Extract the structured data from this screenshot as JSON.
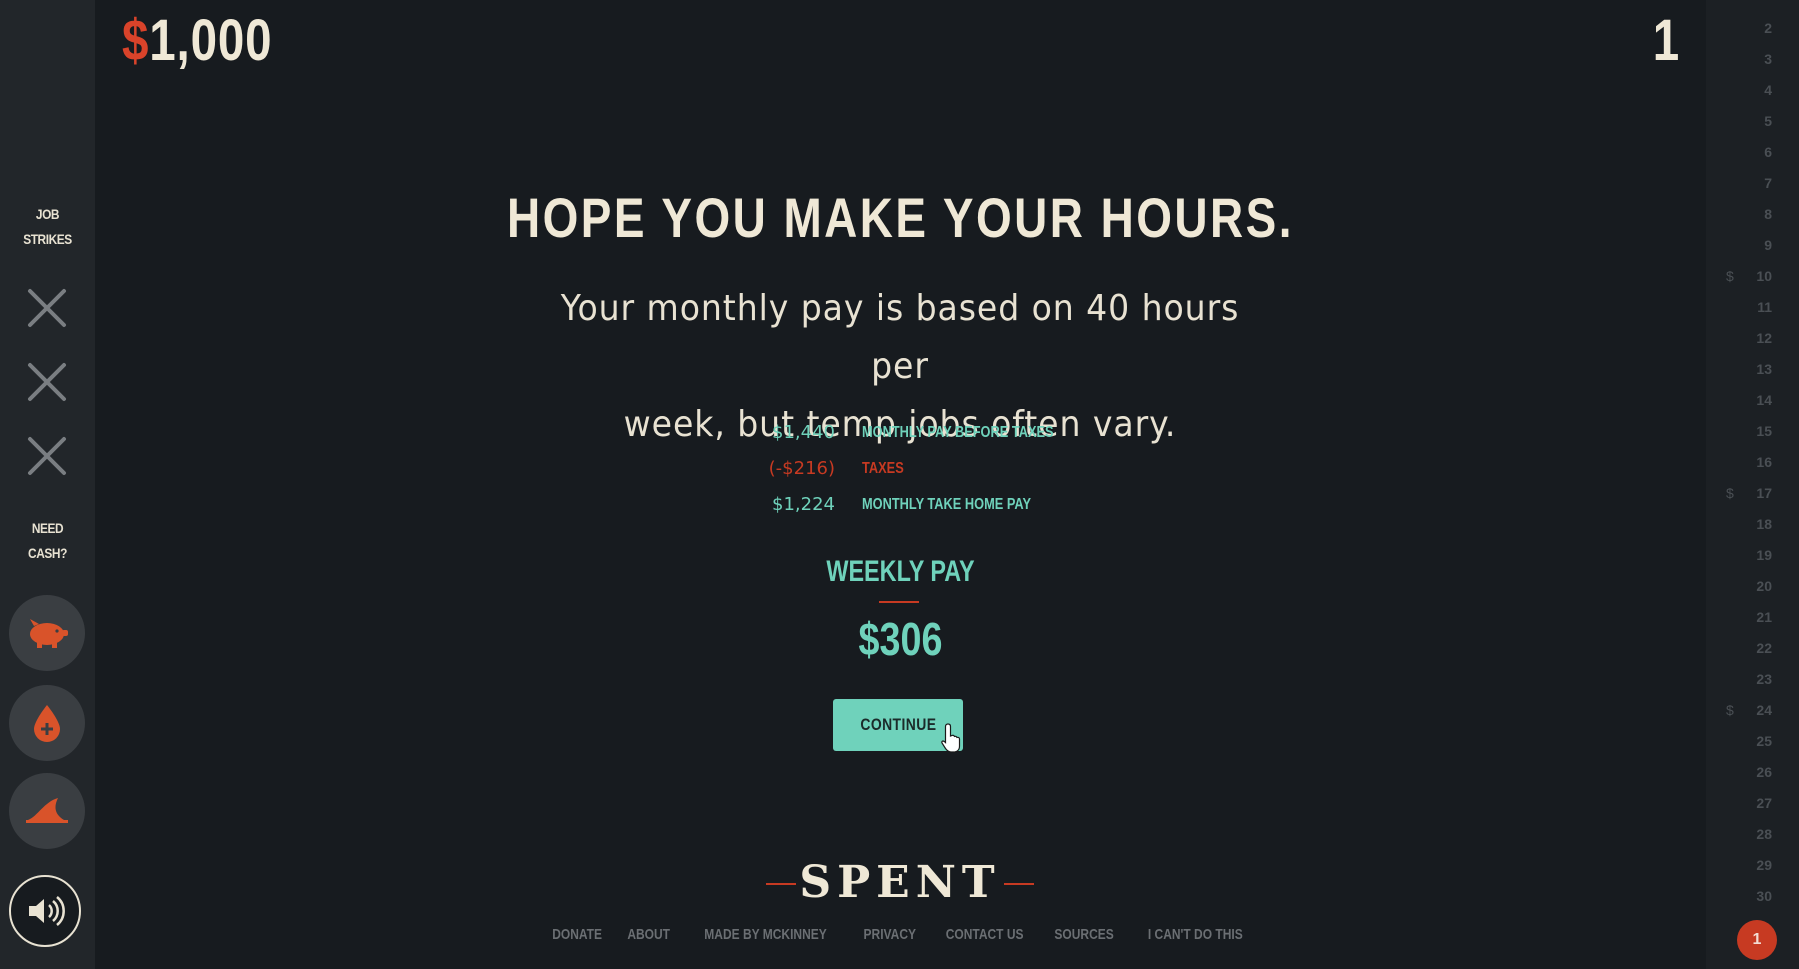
{
  "header": {
    "money_symbol": "$",
    "money_value": "1,000",
    "day": "1"
  },
  "sidebar": {
    "job_strikes_line1": "JOB",
    "job_strikes_line2": "STRIKES",
    "need_cash_line1": "NEED",
    "need_cash_line2": "CASH?",
    "strike_icons": [
      "close-icon",
      "close-icon",
      "close-icon"
    ],
    "cash_options": [
      "piggy-bank-icon",
      "blood-drop-icon",
      "loan-shark-fin-icon"
    ],
    "sound_icon": "speaker-icon"
  },
  "main": {
    "headline": "HOPE YOU MAKE YOUR HOURS.",
    "body_line1": "Your monthly pay is based on 40 hours per",
    "body_line2": "week, but temp jobs often vary.",
    "pay_breakdown": [
      {
        "amount": "$1,440",
        "label": "MONTHLY PAY BEFORE TAXES",
        "color": "#6fd2bb"
      },
      {
        "amount": "(-$216)",
        "label": "TAXES",
        "color": "#c73a22"
      },
      {
        "amount": "$1,224",
        "label": "MONTHLY TAKE HOME PAY",
        "color": "#6fd2bb"
      }
    ],
    "weekly_label": "WEEKLY PAY",
    "weekly_amount": "$306",
    "continue_label": "CONTINUE"
  },
  "footer": {
    "logo": "SPENT",
    "links": [
      "DONATE",
      "ABOUT",
      "MADE BY MCKINNEY",
      "PRIVACY",
      "CONTACT US",
      "SOURCES",
      "I CAN'T DO THIS"
    ]
  },
  "day_column": {
    "days": [
      "2",
      "3",
      "4",
      "5",
      "6",
      "7",
      "8",
      "9",
      "10",
      "11",
      "12",
      "13",
      "14",
      "15",
      "16",
      "17",
      "18",
      "19",
      "20",
      "21",
      "22",
      "23",
      "24",
      "25",
      "26",
      "27",
      "28",
      "29",
      "30"
    ],
    "payday_marker": "$",
    "paydays": [
      "10",
      "17",
      "24"
    ],
    "current_day": "1"
  },
  "colors": {
    "accent_teal": "#6fd2bb",
    "accent_red": "#c73a22",
    "background": "#171b1f"
  }
}
